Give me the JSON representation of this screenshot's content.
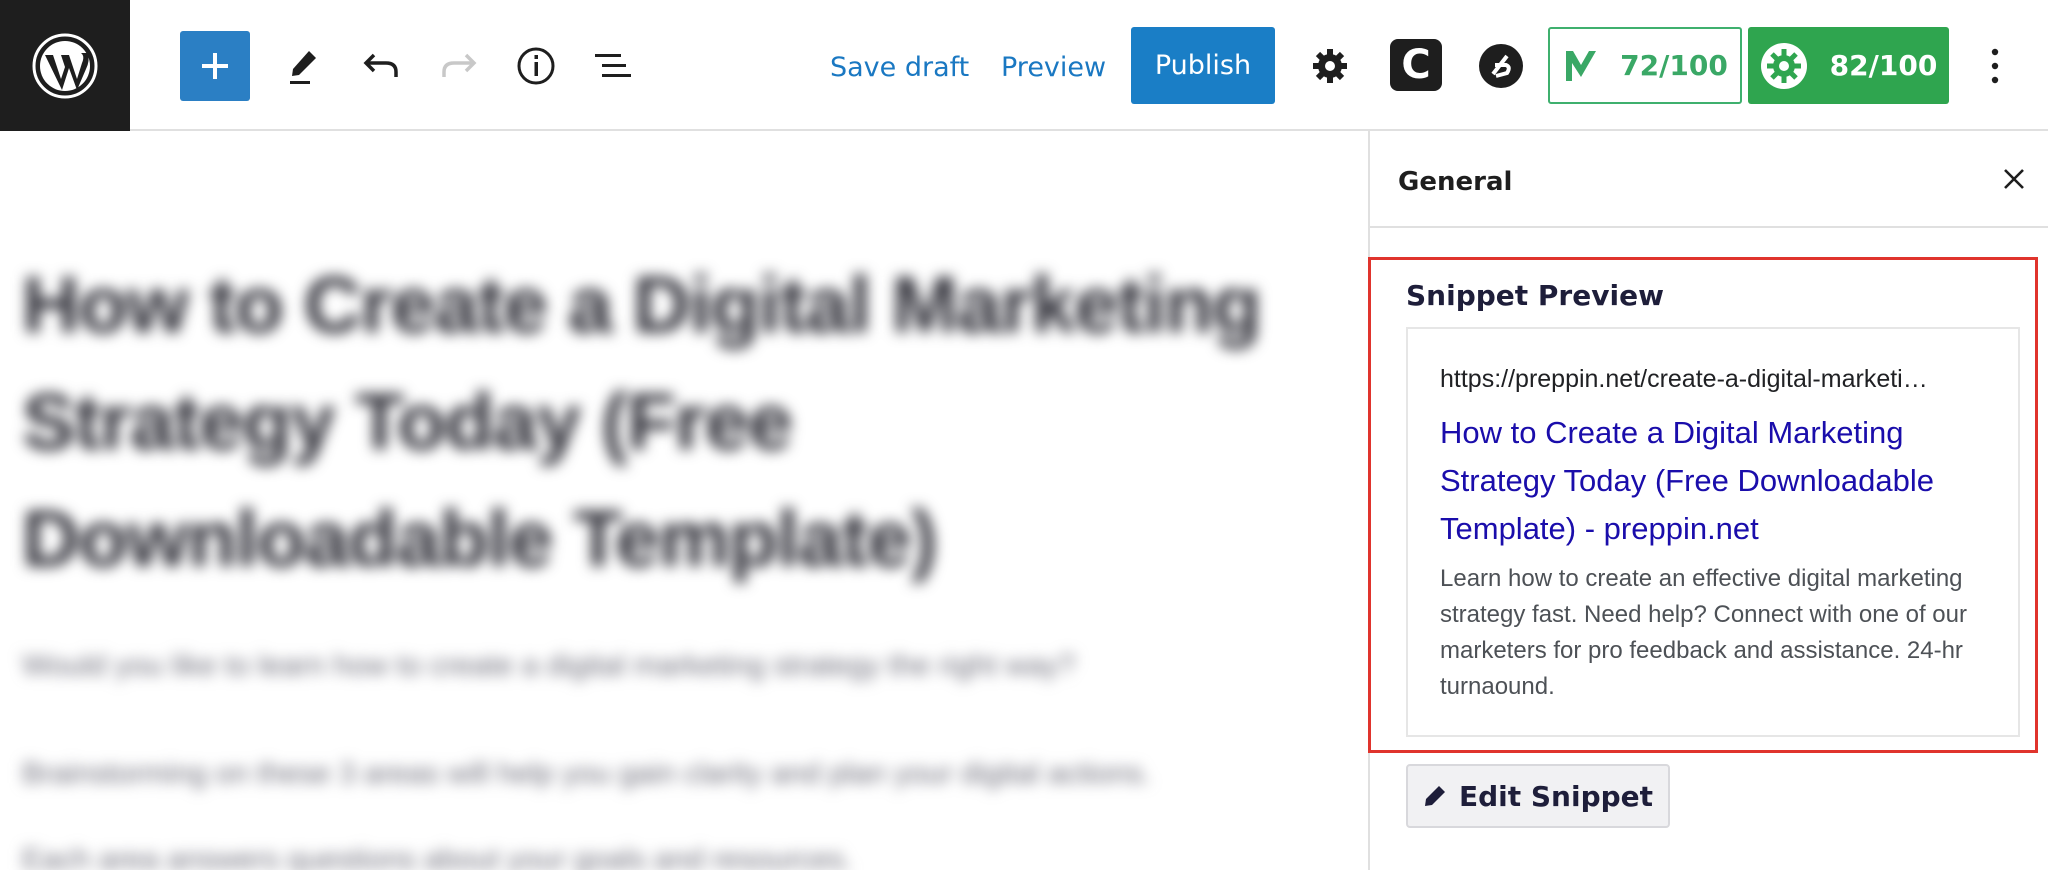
{
  "toolbar": {
    "save_draft": "Save draft",
    "preview": "Preview",
    "publish": "Publish",
    "c_badge": "C",
    "content_score": "72/100",
    "seo_score": "82/100"
  },
  "editor": {
    "post_title": "How to Create a Digital Marketing Strategy Today (Free Downloadable Template)",
    "paragraphs": [
      "Would you like to learn how to create a digital marketing strategy the right way?",
      "Brainstorming on these 3 areas will help you gain clarity and plan your digital actions.",
      "Each area answers questions about your goals and resources."
    ]
  },
  "sidebar": {
    "title": "General",
    "snippet_heading": "Snippet Preview",
    "snippet": {
      "url": "https://preppin.net/create-a-digital-marketi…",
      "title": "How to Create a Digital Marketing Strategy Today (Free Downloadable Template) - preppin.net",
      "description": "Learn how to create an effective digital marketing strategy fast. Need help? Connect with one of our marketers for pro feedback and assistance. 24-hr turnaound."
    },
    "edit_button": "Edit Snippet"
  },
  "colors": {
    "accent_blue": "#1a7ec6",
    "score_green": "#2fa54f",
    "highlight_red": "#e0342d",
    "serp_title": "#1a0dab"
  },
  "icons": [
    "wordpress-logo-icon",
    "plus-icon",
    "pencil-icon",
    "undo-icon",
    "redo-icon",
    "info-icon",
    "list-view-icon",
    "gear-icon",
    "b-badge-icon",
    "content-score-icon",
    "seo-score-icon",
    "more-vertical-icon",
    "close-icon",
    "edit-pencil-icon"
  ]
}
